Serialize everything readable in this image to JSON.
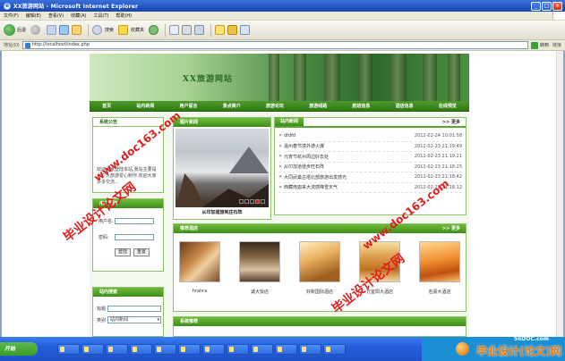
{
  "browser": {
    "title": "XX旅游网站 - Microsoft Internet Explorer",
    "menu": [
      "文件(F)",
      "编辑(E)",
      "查看(V)",
      "收藏(A)",
      "工具(T)",
      "帮助(H)"
    ],
    "toolbar": {
      "back": "后退",
      "search": "搜索",
      "favorites": "收藏夹"
    },
    "address_label": "地址(D)",
    "url": "http://localhost/index.php",
    "go": "转到",
    "links": "链接"
  },
  "site": {
    "banner_title": "XX旅游网站",
    "nav": [
      "首页",
      "站内新闻",
      "用户留言",
      "景点简介",
      "旅游论坛",
      "旅游线路",
      "航班信息",
      "酒店信息",
      "在线预览"
    ],
    "notice": {
      "title": "系统公告",
      "text": "欢迎大家登陆本站,我站主要是为广大旅游爱心制作,欢迎大家多多交流..."
    },
    "login": {
      "title": "用户登陆",
      "username_label": "用户名:",
      "password_label": "密码:",
      "login_btn": "登陆",
      "reset_btn": "重置"
    },
    "search": {
      "title": "站内搜索",
      "keyword_label": "标题",
      "type_label": "类别",
      "type_value": "站内新闻"
    },
    "photo": {
      "title": "图片新闻",
      "caption": "从印加道旅到庄石阵"
    },
    "news": {
      "title": "站内新闻",
      "more": ">> 更多",
      "items": [
        {
          "title": "dfdfd",
          "date": "2012-02-24 10:01:58"
        },
        {
          "title": "温州春节境外游火爆",
          "date": "2012-02-23 21:19:49"
        },
        {
          "title": "元宵节杭州周边好去处",
          "date": "2012-02-23 21:19:21"
        },
        {
          "title": "从印加道徒步旺石阵",
          "date": "2012-02-23 21:18:25"
        },
        {
          "title": "大同武桑古塔北部旅游出发感光",
          "date": "2012-02-23 21:18:42"
        },
        {
          "title": "西藏南迦来大流感降雪天气",
          "date": "2012-02-23 21:18:12"
        }
      ]
    },
    "hotels": {
      "title": "推荐酒店",
      "more": ">> 更多",
      "items": [
        "hrahra",
        "诚大饭店",
        "好新国际酒店",
        "万宜阳大酒店",
        "名豪大酒店"
      ]
    },
    "routes": {
      "title": "系统推荐"
    }
  },
  "watermarks": {
    "text1": "毕业设计论文网",
    "url1": "www.doc163.com",
    "text2": "毕业设计论文网",
    "url2": "www.doc163.com"
  },
  "taskbar": {
    "start": "开始",
    "tasks": [
      "",
      "",
      "",
      "",
      "",
      "",
      "",
      "",
      "",
      "",
      "",
      "",
      "",
      "",
      "",
      ""
    ],
    "brand_small": "56DOC.com",
    "brand_big": "毕业设计(论文)网"
  },
  "colors": {
    "site_green": "#3e8e1a",
    "watermark_red": "#e02020"
  }
}
